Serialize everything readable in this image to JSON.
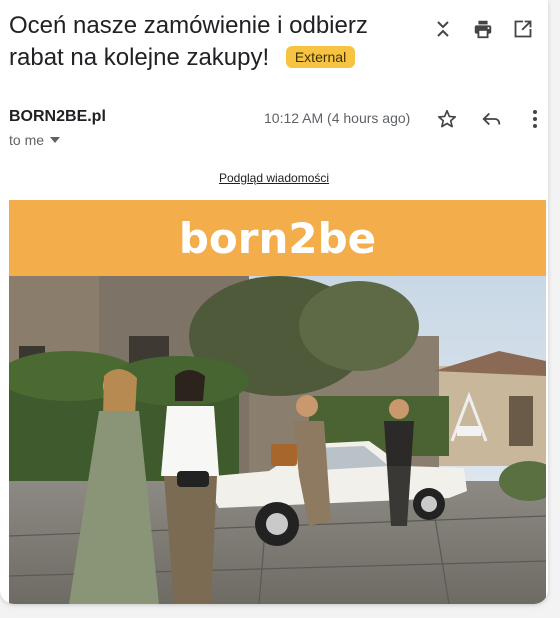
{
  "email": {
    "subject": "Oceń nasze zamówienie i odbierz rabat na kolejne zakupy!",
    "badge": "External",
    "sender": "BORN2BE.pl",
    "recipient": "to me",
    "time": "10:12 AM (4 hours ago)"
  },
  "body": {
    "preview_link": "Podgląd wiadomości",
    "brand_logo": "born2be"
  },
  "icons": {
    "collapse": "collapse-icon",
    "print": "print-icon",
    "open_new": "open-in-new-window-icon",
    "star": "star-icon",
    "reply": "reply-icon",
    "more": "more-vertical-icon",
    "dropdown": "caret-down-icon"
  },
  "colors": {
    "badge": "#f6c343",
    "brand_bar": "#f3ad4b"
  }
}
